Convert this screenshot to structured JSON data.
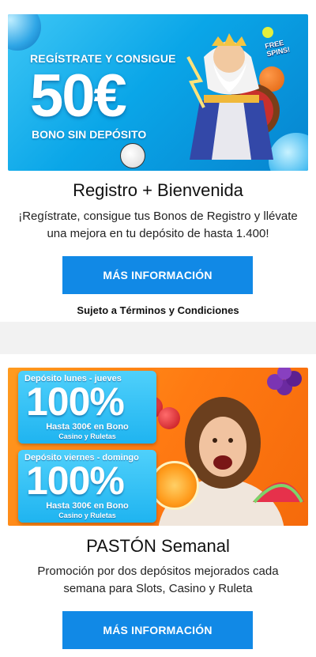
{
  "promo1": {
    "banner": {
      "line1": "REGÍSTRATE Y CONSIGUE",
      "amount": "50€",
      "line3": "BONO SIN DEPÓSITO",
      "corner_text": "FREE SPINS!"
    },
    "title": "Registro + Bienvenida",
    "description": "¡Regístrate, consigue tus Bonos de Registro y llévate una mejora en tu depósito de hasta 1.400!",
    "button_label": "MÁS INFORMACIÓN",
    "terms": "Sujeto a Términos y Condiciones"
  },
  "promo2": {
    "banner": {
      "box1": {
        "head": "Depósito lunes - jueves",
        "percent": "100%",
        "line": "Hasta 300€ en Bono",
        "small": "Casino y Ruletas"
      },
      "box2": {
        "head": "Depósito viernes - domingo",
        "percent": "100%",
        "line": "Hasta 300€ en Bono",
        "small": "Casino y Ruletas"
      }
    },
    "title": "PASTÓN Semanal",
    "description": "Promoción por dos depósitos mejorados cada semana para Slots, Casino y Ruleta",
    "button_label": "MÁS INFORMACIÓN"
  },
  "colors": {
    "button": "#1189e6",
    "banner1": "#0aa6e8",
    "banner2": "#ff7a12"
  }
}
